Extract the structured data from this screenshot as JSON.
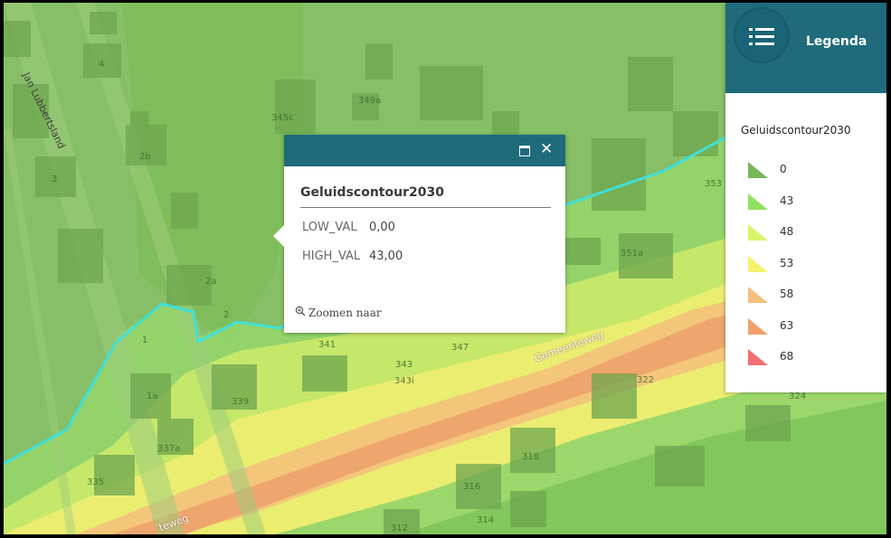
{
  "map": {
    "street_labels": [
      "Jan Lubbertsland"
    ],
    "road_labels": [
      "Gemeenteweg",
      "teweg"
    ],
    "house_numbers": [
      "4",
      "2b",
      "3",
      "345c",
      "349a",
      "2a",
      "2",
      "1",
      "1a",
      "339",
      "337a",
      "335",
      "341",
      "343",
      "343i",
      "347",
      "351a",
      "353",
      "322",
      "324",
      "318",
      "316",
      "314",
      "312"
    ]
  },
  "popup": {
    "title": "Geluidscontour2030",
    "attributes": [
      {
        "key": "LOW_VAL",
        "value": "0,00"
      },
      {
        "key": "HIGH_VAL",
        "value": "43,00"
      }
    ],
    "zoom_label": "Zoomen naar",
    "maximize_icon": "maximize-icon",
    "close_icon": "close-icon",
    "close_glyph": "✕"
  },
  "legend": {
    "title": "Legenda",
    "toggle_icon": "list-icon",
    "layer_name": "Geluidscontour2030",
    "items": [
      {
        "label": "0",
        "color": "#77b85a"
      },
      {
        "label": "43",
        "color": "#92e05f"
      },
      {
        "label": "48",
        "color": "#d8f56a"
      },
      {
        "label": "53",
        "color": "#f6f26e"
      },
      {
        "label": "58",
        "color": "#f6be7b"
      },
      {
        "label": "63",
        "color": "#f2a06a"
      },
      {
        "label": "68",
        "color": "#f27070"
      }
    ]
  },
  "colors": {
    "header": "#1f6b7c",
    "contour_line": "#3fe0d8"
  }
}
